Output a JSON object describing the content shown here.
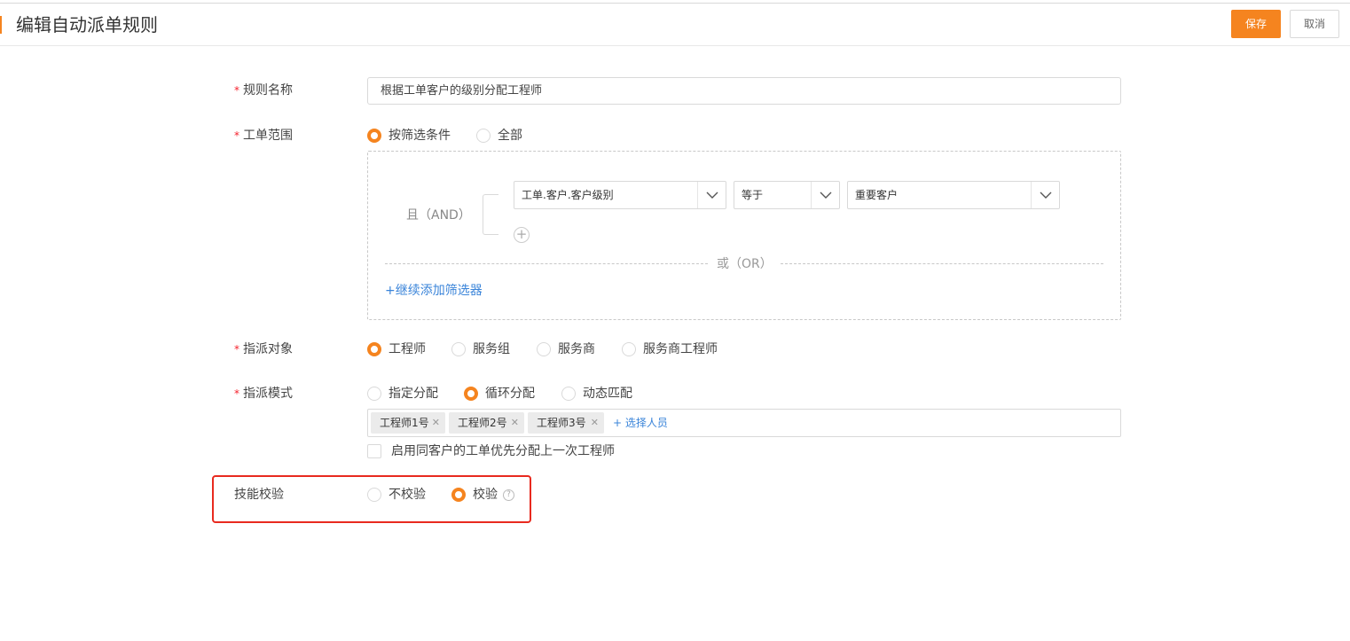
{
  "header": {
    "title": "编辑自动派单规则",
    "save_label": "保存",
    "cancel_label": "取消"
  },
  "form": {
    "rule_name": {
      "label": "规则名称",
      "value": "根据工单客户的级别分配工程师"
    },
    "scope": {
      "label": "工单范围",
      "options": [
        {
          "label": "按筛选条件",
          "selected": true
        },
        {
          "label": "全部",
          "selected": false
        }
      ],
      "filter": {
        "and_label": "且（AND）",
        "conditions": [
          {
            "field": "工单.客户.客户级别",
            "operator": "等于",
            "value": "重要客户"
          }
        ],
        "or_label": "或（OR）",
        "add_filter_label": "+继续添加筛选器"
      }
    },
    "assign_target": {
      "label": "指派对象",
      "options": [
        {
          "label": "工程师",
          "selected": true
        },
        {
          "label": "服务组",
          "selected": false
        },
        {
          "label": "服务商",
          "selected": false
        },
        {
          "label": "服务商工程师",
          "selected": false
        }
      ]
    },
    "assign_mode": {
      "label": "指派模式",
      "options": [
        {
          "label": "指定分配",
          "selected": false
        },
        {
          "label": "循环分配",
          "selected": true
        },
        {
          "label": "动态匹配",
          "selected": false
        }
      ],
      "tags": [
        "工程师1号",
        "工程师2号",
        "工程师3号"
      ],
      "add_person_label": "+ 选择人员",
      "checkbox_label": "启用同客户的工单优先分配上一次工程师",
      "checkbox_checked": false
    },
    "skill_check": {
      "label": "技能校验",
      "options": [
        {
          "label": "不校验",
          "selected": false
        },
        {
          "label": "校验",
          "selected": true
        }
      ]
    }
  },
  "colors": {
    "accent": "#f5841f",
    "link": "#3a84d9",
    "highlight_border": "#e82a1f",
    "required_star": "#f5222d"
  },
  "icons": {
    "dropdown": "chevron-down-icon",
    "add_condition": "plus-circle-icon",
    "tag_remove": "close-icon",
    "help": "question-circle-icon"
  }
}
